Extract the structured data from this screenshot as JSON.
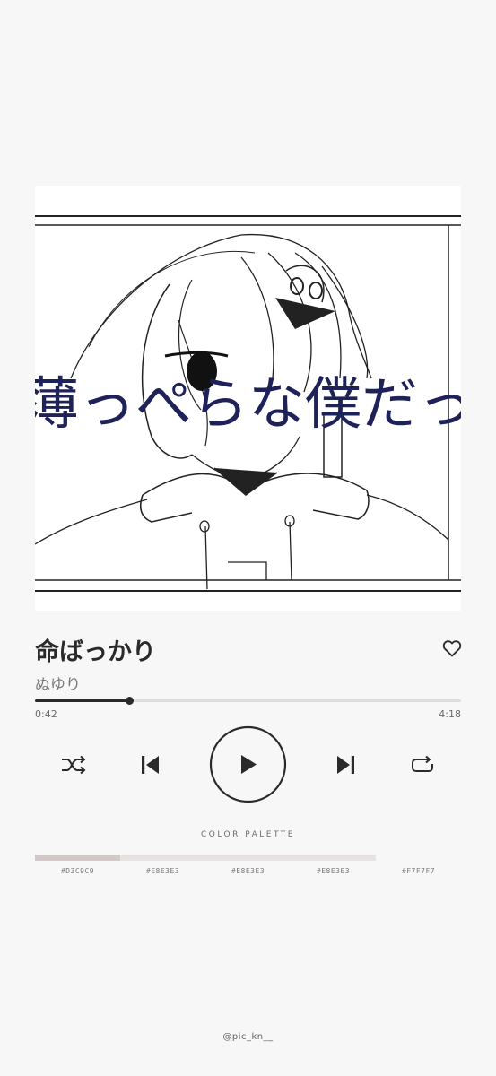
{
  "artwork": {
    "lyric_text": "薄っぺらな僕だった"
  },
  "track": {
    "title": "命ばっかり",
    "artist": "ぬゆり",
    "progress_fraction": 0.221,
    "current_time": "0:42",
    "total_time": "4:18"
  },
  "icons": {
    "favorite": "heart-outline-icon",
    "shuffle": "shuffle-icon",
    "previous": "skip-previous-icon",
    "play": "play-icon",
    "next": "skip-next-icon",
    "repeat": "repeat-icon"
  },
  "palette": {
    "label": "COLOR PALETTE",
    "colors": [
      {
        "hex": "#D3C9C9",
        "label": "#D3C9C9"
      },
      {
        "hex": "#E8E3E3",
        "label": "#E8E3E3"
      },
      {
        "hex": "#E8E3E3",
        "label": "#E8E3E3"
      },
      {
        "hex": "#E8E3E3",
        "label": "#E8E3E3"
      },
      {
        "hex": "#F7F7F7",
        "label": "#F7F7F7"
      }
    ]
  },
  "footer": {
    "handle": "@pic_kn__"
  },
  "colors": {
    "background": "#f7f7f7",
    "accent": "#2a2a2a",
    "lyric": "#1f2258"
  }
}
